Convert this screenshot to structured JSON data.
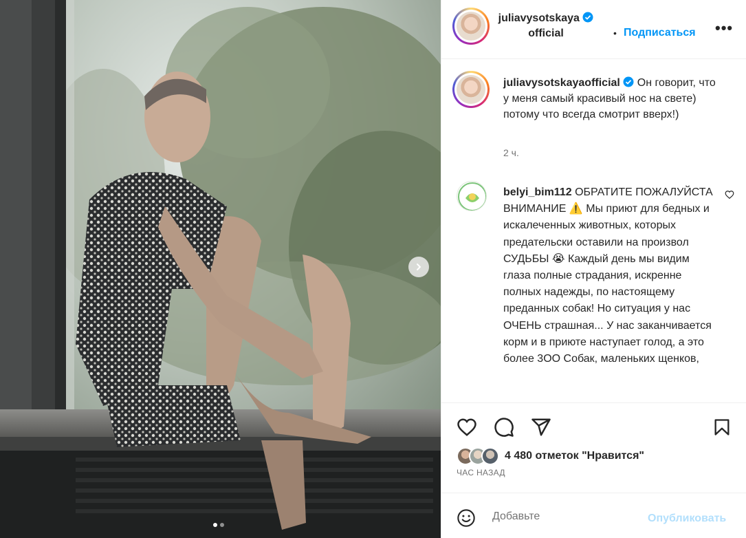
{
  "post": {
    "username": "juliavysotskaya",
    "username_line2": "official",
    "follow_label": "Подписаться",
    "more_label": "•••",
    "separator": "•"
  },
  "caption": {
    "username": "juliavysotskayaofficial",
    "text": "Он говорит, что у меня самый красивый нос на свете) потому что всегда смотрит вверх!)",
    "time": "2 ч."
  },
  "comment": {
    "username": "belyi_bim112",
    "text": "ОБРАТИТЕ ПОЖАЛУЙСТА ВНИМАНИЕ ⚠️ Мы приют для бедных и искалеченных животных, которых предательски оставили на произвол СУДЬБЫ 😭 Каждый день мы видим глаза полные страдания, искренне полных надежды, по настоящему преданных собак! Но ситуация у нас ОЧЕНЬ страшная... У нас заканчивается корм и в приюте наступает голод, а это более 3ОО Собак, маленьких щенков,"
  },
  "stats": {
    "likes": "4 480 отметок \"Нравится\"",
    "posted": "ЧАС НАЗАД"
  },
  "add_comment": {
    "placeholder": "Добавьте",
    "publish_label": "Опубликовать"
  },
  "media": {
    "slide_index": 1,
    "slide_count": 2
  },
  "colors": {
    "link": "#0095f6",
    "verified": "#0095f6",
    "publish_disabled": "#b2dffc",
    "muted": "#737373"
  },
  "icons": [
    "verified-badge-icon",
    "more-options-icon",
    "heart-icon",
    "comment-icon",
    "share-icon",
    "bookmark-icon",
    "emoji-icon",
    "chevron-right-icon"
  ]
}
